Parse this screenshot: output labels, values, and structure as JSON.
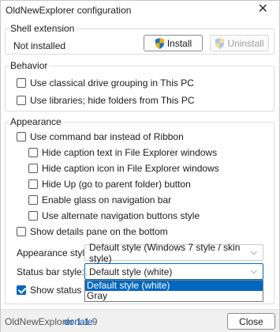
{
  "window": {
    "title": "OldNewExplorer configuration",
    "close_glyph": "✕"
  },
  "shell": {
    "legend": "Shell extension",
    "status": "Not installed",
    "install_label": "Install",
    "uninstall_label": "Uninstall"
  },
  "behavior": {
    "legend": "Behavior",
    "items": [
      {
        "label": "Use classical drive grouping in This PC",
        "checked": false
      },
      {
        "label": "Use libraries; hide folders from This PC",
        "checked": false
      }
    ]
  },
  "appearance": {
    "legend": "Appearance",
    "items": [
      {
        "label": "Use command bar instead of Ribbon",
        "checked": false
      },
      {
        "label": "Hide caption text in File Explorer windows",
        "checked": false
      },
      {
        "label": "Hide caption icon in File Explorer windows",
        "checked": false
      },
      {
        "label": "Hide Up (go to parent folder) button",
        "checked": false
      },
      {
        "label": "Enable glass on navigation bar",
        "checked": false
      },
      {
        "label": "Use alternate navigation buttons style",
        "checked": false
      },
      {
        "label": "Show details pane on the bottom",
        "checked": false
      }
    ],
    "style_label": "Appearance style:",
    "style_value": "Default style (Windows 7 style / skin style)",
    "statusbar_label": "Status bar style:",
    "statusbar_value": "Default style (white)",
    "statusbar_options": [
      "Default style (white)",
      "Gray"
    ],
    "show_status_label": "Show status bar",
    "show_status_checked": true
  },
  "footer": {
    "version": "OldNewExplorer 1.1.9",
    "donate": "donate",
    "close_label": "Close"
  },
  "colors": {
    "accent": "#0067c0",
    "link": "#0a5cc2"
  }
}
